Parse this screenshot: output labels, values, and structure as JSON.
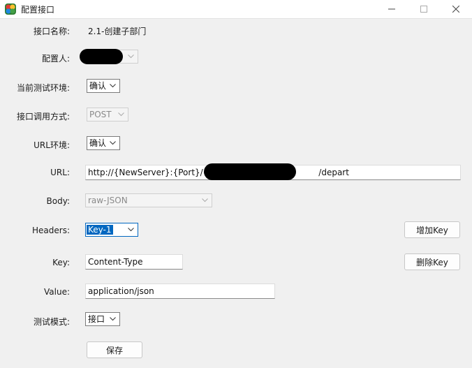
{
  "window": {
    "title": "配置接口",
    "app_icon": "colorful-app-icon",
    "controls": [
      "minimize-icon",
      "maximize-icon",
      "close-icon"
    ]
  },
  "form": {
    "interface_name": {
      "label": "接口名称:",
      "value": "2.1-创建子部门"
    },
    "configurer": {
      "label": "配置人:",
      "value": ""
    },
    "test_env": {
      "label": "当前测试环境:",
      "value": "确认"
    },
    "call_method": {
      "label": "接口调用方式:",
      "value": "POST"
    },
    "url_env": {
      "label": "URL环境:",
      "value": "确认"
    },
    "url": {
      "label": "URL:",
      "value_prefix": "http://{NewServer}:{Port}/{api}",
      "value_suffix": "/depart"
    },
    "body": {
      "label": "Body:",
      "value": "raw-JSON"
    },
    "headers": {
      "label": "Headers:",
      "value": "Key-1",
      "add_button": "增加Key"
    },
    "key": {
      "label": "Key:",
      "value": "Content-Type",
      "delete_button": "删除Key"
    },
    "value": {
      "label": "Value:",
      "value": "application/json"
    },
    "test_mode": {
      "label": "测试模式:",
      "value": "接口"
    }
  },
  "actions": {
    "save": "保存"
  },
  "colors": {
    "selection": "#0067c0",
    "background": "#f0f0f0",
    "redaction": "#000000"
  }
}
